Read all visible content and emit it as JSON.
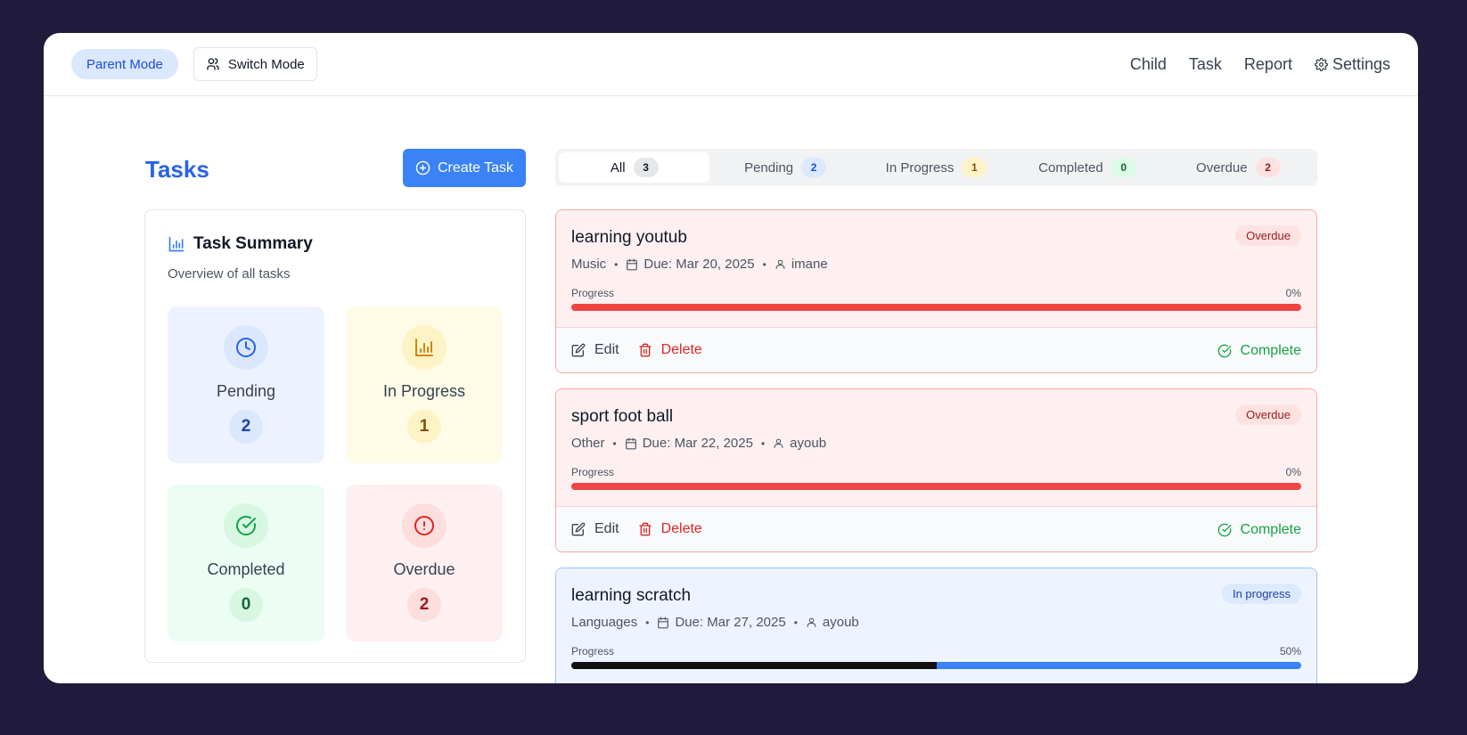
{
  "header": {
    "mode_label": "Parent Mode",
    "switch_label": "Switch Mode",
    "nav": [
      "Child",
      "Task",
      "Report",
      "Settings"
    ]
  },
  "page": {
    "title": "Tasks",
    "create_label": "Create Task"
  },
  "summary": {
    "title": "Task Summary",
    "subtitle": "Overview of all tasks",
    "stats": [
      {
        "label": "Pending",
        "count": "2",
        "icon": "clock-icon",
        "bg": "#edf3fe",
        "circle": "#dbe7fd",
        "color": "#2563eb"
      },
      {
        "label": "In Progress",
        "count": "1",
        "icon": "chart-icon",
        "bg": "#fefbe6",
        "circle": "#fef3c7",
        "color": "#ca8a04"
      },
      {
        "label": "Completed",
        "count": "0",
        "icon": "check-circle-icon",
        "bg": "#ecfdf3",
        "circle": "#d8f7e2",
        "color": "#16a34a"
      },
      {
        "label": "Overdue",
        "count": "2",
        "icon": "alert-circle-icon",
        "bg": "#fef0f0",
        "circle": "#fddede",
        "color": "#dc2626"
      }
    ]
  },
  "tabs": [
    {
      "label": "All",
      "count": "3",
      "active": true,
      "badge_bg": "#e5e7eb",
      "badge_color": "#111827"
    },
    {
      "label": "Pending",
      "count": "2",
      "active": false,
      "badge_bg": "#dbeafe",
      "badge_color": "#1d4ed8"
    },
    {
      "label": "In Progress",
      "count": "1",
      "active": false,
      "badge_bg": "#fef3c7",
      "badge_color": "#854d0e"
    },
    {
      "label": "Completed",
      "count": "0",
      "active": false,
      "badge_bg": "#dcfce7",
      "badge_color": "#166534"
    },
    {
      "label": "Overdue",
      "count": "2",
      "active": false,
      "badge_bg": "#fee2e2",
      "badge_color": "#991b1b"
    }
  ],
  "tasks": [
    {
      "title": "learning youtub",
      "status": "Overdue",
      "category": "Music",
      "due": "Due: Mar 20, 2025",
      "assignee": "imane",
      "progress_label": "Progress",
      "progress_value": "0%",
      "progress": 0,
      "edit": "Edit",
      "delete": "Delete",
      "complete": "Complete"
    },
    {
      "title": "sport foot ball",
      "status": "Overdue",
      "category": "Other",
      "due": "Due: Mar 22, 2025",
      "assignee": "ayoub",
      "progress_label": "Progress",
      "progress_value": "0%",
      "progress": 0,
      "edit": "Edit",
      "delete": "Delete",
      "complete": "Complete"
    },
    {
      "title": "learning scratch",
      "status": "In progress",
      "category": "Languages",
      "due": "Due: Mar 27, 2025",
      "assignee": "ayoub",
      "progress_label": "Progress",
      "progress_value": "50%",
      "progress": 0.5
    }
  ],
  "colors": {
    "accent": "#3b82f6",
    "overdue_bar": "#ef4444",
    "progress_fill": "#111111",
    "progress_track": "#3b82f6"
  }
}
